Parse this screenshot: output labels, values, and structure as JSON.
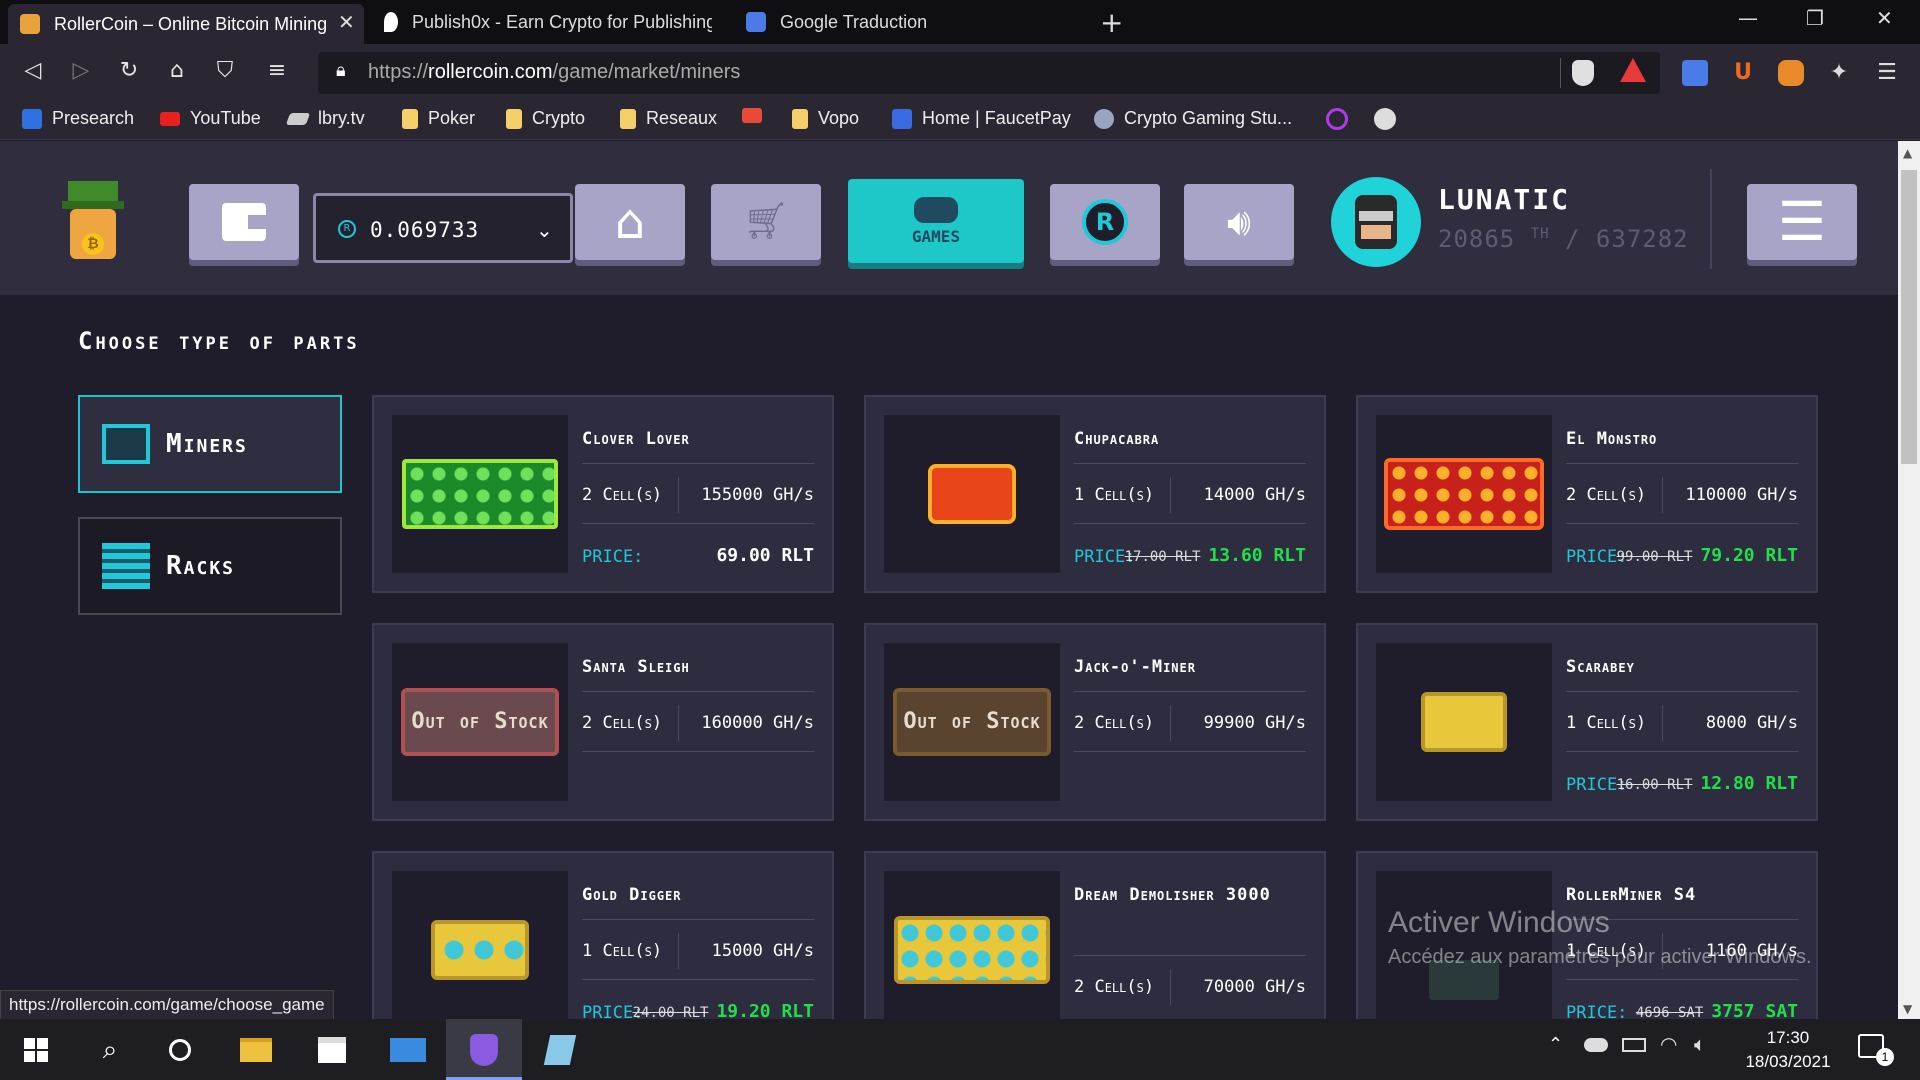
{
  "tabs": [
    {
      "title": "RollerCoin – Online Bitcoin Mining",
      "close": "✕"
    },
    {
      "title": "Publish0x - Earn Crypto for Publishing"
    },
    {
      "title": "Google Traduction"
    }
  ],
  "new_tab": "+",
  "window": {
    "minimize": "—",
    "restore": "❐",
    "close": "✕"
  },
  "url": {
    "scheme": "https://",
    "host": "rollercoin.com",
    "path": "/game/market/miners"
  },
  "bookmarks": [
    "Presearch",
    "YouTube",
    "lbry.tv",
    "Poker",
    "Crypto",
    "Reseaux",
    "",
    "Vopo",
    "Home | FaucetPay",
    "Crypto Gaming Stu..."
  ],
  "header": {
    "balance": "0.069733",
    "games_label": "GAMES",
    "username": "LUNATIC",
    "power_value": "20865",
    "power_unit": "TH",
    "power_total": "/ 637282"
  },
  "section_title": "Choose type of parts",
  "categories": [
    {
      "label": "Miners"
    },
    {
      "label": "Racks"
    }
  ],
  "price_label": "PRICE:",
  "miners": [
    {
      "name": "Clover Lover",
      "cells": "2 Cell(s)",
      "power": "155000 GH/s",
      "price": "69.00 RLT",
      "old_price": ""
    },
    {
      "name": "Chupacabra",
      "cells": "1 Cell(s)",
      "power": "14000 GH/s",
      "price": "13.60 RLT",
      "old_price": "17.00 RLT"
    },
    {
      "name": "El Monstro",
      "cells": "2 Cell(s)",
      "power": "110000 GH/s",
      "price": "79.20 RLT",
      "old_price": "99.00 RLT"
    },
    {
      "name": "Santa Sleigh",
      "cells": "2 Cell(s)",
      "power": "160000 GH/s",
      "out_of_stock": "Out of Stock"
    },
    {
      "name": "Jack-o'-Miner",
      "cells": "2 Cell(s)",
      "power": "99900 GH/s",
      "out_of_stock": "Out of Stock"
    },
    {
      "name": "Scarabey",
      "cells": "1 Cell(s)",
      "power": "8000 GH/s",
      "price": "12.80 RLT",
      "old_price": "16.00 RLT"
    },
    {
      "name": "Gold Digger",
      "cells": "1 Cell(s)",
      "power": "15000 GH/s",
      "price": "19.20 RLT",
      "old_price": "24.00 RLT"
    },
    {
      "name": "Dream Demolisher 3000",
      "cells": "2 Cell(s)",
      "power": "70000 GH/s"
    },
    {
      "name": "RollerMiner S4",
      "cells": "1 Cell(s)",
      "power": "1160 GH/s",
      "price": "3757 SAT",
      "old_price": "4696 SAT"
    }
  ],
  "watermark": {
    "line1": "Activer Windows",
    "line2": "Accédez aux paramètres pour activer Windows."
  },
  "status_url": "https://rollercoin.com/game/choose_game",
  "clock": {
    "time": "17:30",
    "date": "18/03/2021"
  },
  "notifications": "1",
  "colors": {
    "accent": "#20c8d8",
    "discount": "#20e04a",
    "header": "#2f2d3e"
  }
}
